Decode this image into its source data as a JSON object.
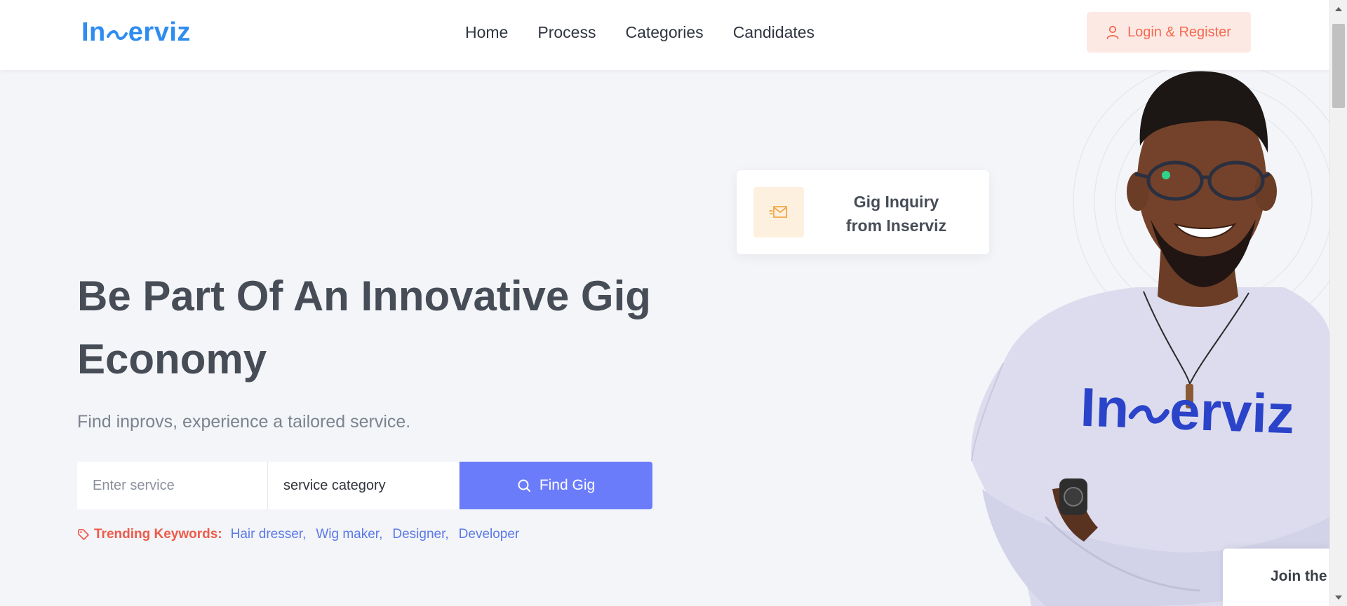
{
  "header": {
    "logo_text_left": "In",
    "logo_text_right": "erviz",
    "nav": [
      {
        "label": "Home"
      },
      {
        "label": "Process"
      },
      {
        "label": "Categories"
      },
      {
        "label": "Candidates"
      }
    ],
    "login_label": "Login & Register"
  },
  "hero": {
    "title": "Be Part Of An Innovative Gig Economy",
    "subtitle": "Find inprovs, experience a tailored service.",
    "search": {
      "service_placeholder": "Enter service",
      "category_value": "service category",
      "button_label": "Find Gig"
    },
    "trending": {
      "label": "Trending Keywords:",
      "keywords": [
        "Hair dresser,",
        "Wig maker,",
        "Designer,",
        "Developer"
      ]
    }
  },
  "inquiry_card": {
    "text": "Gig Inquiry from Inserviz"
  },
  "person_shirt": {
    "text_left": "In",
    "text_right": "erviz"
  },
  "join_card": {
    "text": "Join the"
  },
  "colors": {
    "brand_blue": "#2f8cf0",
    "accent_indigo": "#6b7cfb",
    "coral": "#f4694f",
    "trending_red": "#ef5a4a",
    "keyword_blue": "#5b78e8"
  }
}
